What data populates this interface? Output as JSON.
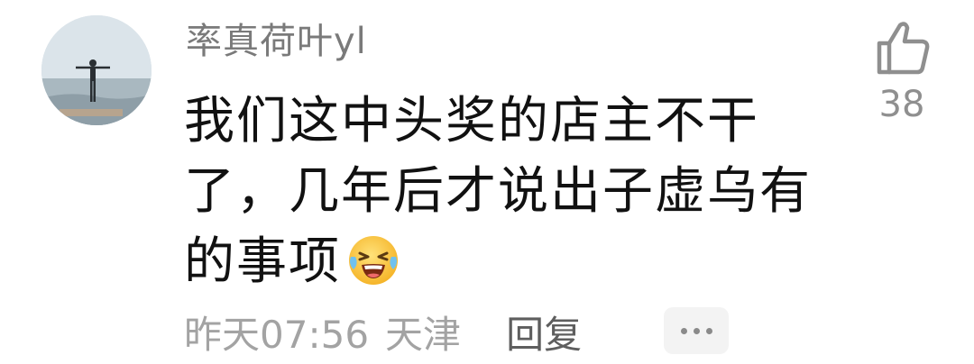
{
  "comment": {
    "username": "率真荷叶yl",
    "content": "我们这中头奖的店主不干了，几年后才说出子虚乌有的事项",
    "emoji": "laughing-crying-face",
    "timestamp": "昨天07:56",
    "location": "天津",
    "reply_label": "回复",
    "more_label": "···",
    "like_count": "38"
  },
  "icons": {
    "like": "thumbs-up-icon",
    "more": "more-dots-icon"
  }
}
